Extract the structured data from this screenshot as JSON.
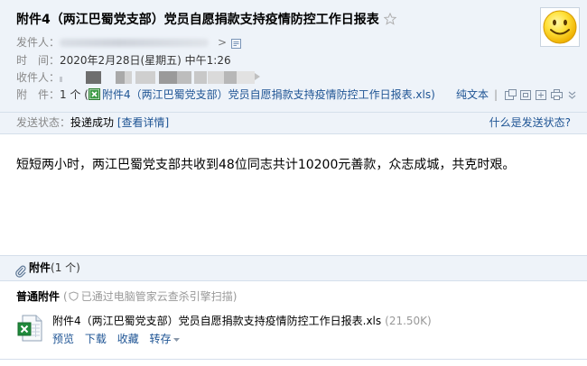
{
  "colors": {
    "header_bg": "#eef3f9",
    "border": "#d5dfeb",
    "link": "#1e5494",
    "label": "#888888",
    "muted": "#999999"
  },
  "header": {
    "subject": "附件4（两江巴蜀党支部）党员自愿捐款支持疫情防控工作日报表",
    "star_icon": "star-outline-icon",
    "avatar_icon": "smiley-face-icon",
    "sender": {
      "label": "发件人：",
      "arrow": ">",
      "card_icon": "contact-card-icon"
    },
    "time": {
      "label": "时　间：",
      "value": "2020年2月28日(星期五) 中午1:26"
    },
    "recipient": {
      "label": "收件人："
    },
    "attachment": {
      "label": "附　件：",
      "count": "1 个 (",
      "file_icon": "excel-file-icon",
      "file_name": "附件4（两江巴蜀党支部）党员自愿捐款支持疫情防控工作日报表.xls",
      "close": ")"
    },
    "tools": {
      "plain_text": "纯文本",
      "separator": "|",
      "icons": [
        "new-window-icon",
        "window-icon",
        "save-icon",
        "print-icon",
        "expand-more-icon"
      ]
    }
  },
  "status": {
    "label": "发送状态：",
    "value": "投递成功",
    "details_link": "[查看详情]",
    "help_link": "什么是发送状态?"
  },
  "body": {
    "text": "短短两小时，两江巴蜀党支部共收到48位同志共计10200元善款，众志成城，共克时艰。"
  },
  "attachments": {
    "clip_icon": "paperclip-icon",
    "title": "附件",
    "count": "(1 个)",
    "group_label": "普通附件",
    "scan_open": "(",
    "scan_icon": "shield-icon",
    "scan_text": "已通过电脑管家云查杀引擎扫描",
    "scan_close": ")",
    "files": [
      {
        "icon": "excel-file-icon",
        "name": "附件4（两江巴蜀党支部）党员自愿捐款支持疫情防控工作日报表.xls",
        "size": "(21.50K)",
        "actions": [
          "预览",
          "下载",
          "收藏",
          "转存"
        ],
        "more_icon": "dropdown-caret-icon"
      }
    ]
  }
}
